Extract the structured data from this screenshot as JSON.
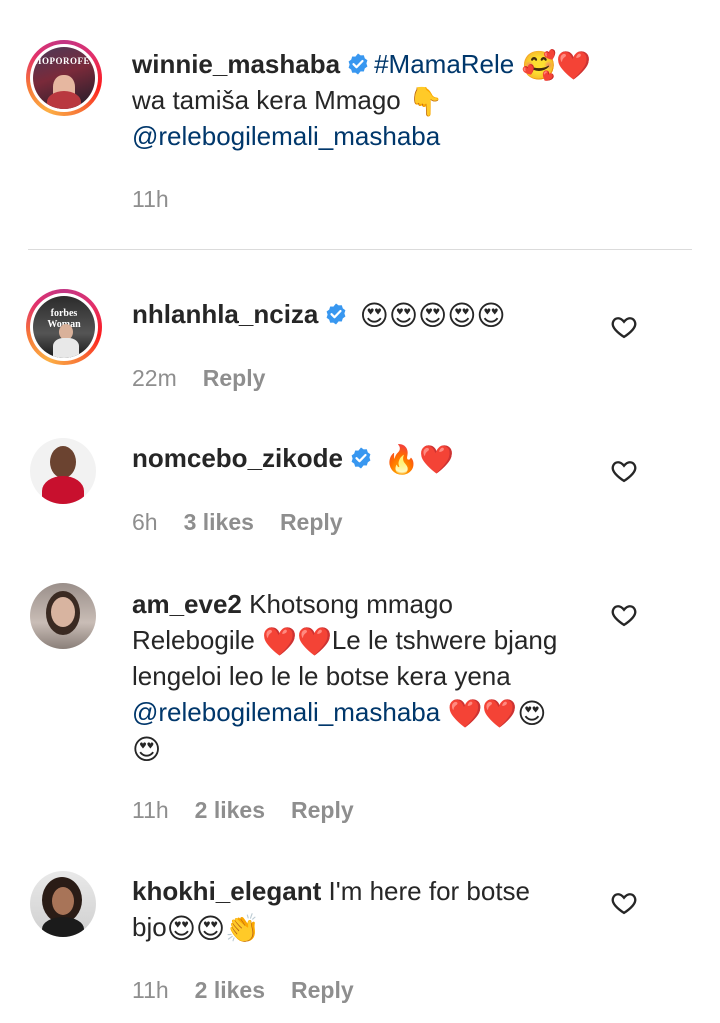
{
  "colors": {
    "link": "#00376b",
    "muted": "#8e8e8e",
    "verified": "#3897f0",
    "heart": "#ed4956"
  },
  "caption": {
    "username": "winnie_mashaba",
    "hashtag": "#MamaRele",
    "emojis_line1": "🥰❤️",
    "line2": "wa tamiša kera Mmago",
    "line2_emoji": "👇",
    "mention": "@relebogilemali_mashaba",
    "time": "11h",
    "avatar_text": "MOPOROFETA"
  },
  "comments": [
    {
      "username": "nhlanhla_nciza",
      "emojis": "😍😍😍😍😍",
      "time": "22m",
      "reply": "Reply",
      "avatar_text": "forbes Woman"
    },
    {
      "username": "nomcebo_zikode",
      "emojis": "🔥❤️",
      "time": "6h",
      "likes": "3 likes",
      "reply": "Reply"
    },
    {
      "username": "am_eve2",
      "text1": "Khotsong mmago",
      "text2a": "Relebogile",
      "text2_emoji": "❤️❤️",
      "text2b": "Le le tshwere bjang",
      "text3": "lengeloi leo le le botse kera yena",
      "mention": "@relebogilemali_mashaba",
      "text4_emoji": "❤️❤️😍",
      "text5_emoji": "😍",
      "time": "11h",
      "likes": "2 likes",
      "reply": "Reply"
    },
    {
      "username": "khokhi_elegant",
      "text1": "I'm here for botse",
      "text2": "bjo",
      "text2_emoji": "😍😍👏",
      "time": "11h",
      "likes": "2 likes",
      "reply": "Reply"
    }
  ]
}
